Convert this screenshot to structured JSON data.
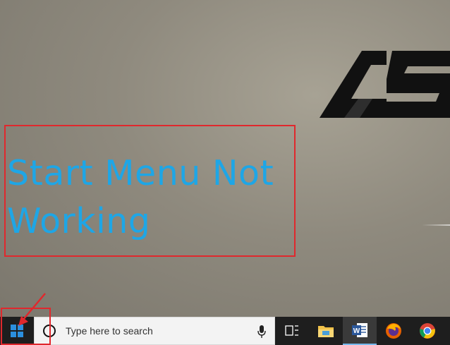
{
  "desktop": {
    "wallpaper_logo": "ASUS",
    "callout_text": "Start Menu Not Working",
    "callout_color": "#1ea6e6",
    "annotation_color": "#e0282d"
  },
  "taskbar": {
    "start_icon": "windows-logo-icon",
    "search_placeholder": "Type here to search",
    "apps": [
      {
        "name": "task-view",
        "icon": "task-view-icon"
      },
      {
        "name": "file-explorer",
        "icon": "folder-icon"
      },
      {
        "name": "word",
        "icon": "word-icon",
        "active": true
      },
      {
        "name": "firefox",
        "icon": "firefox-icon"
      },
      {
        "name": "chrome",
        "icon": "chrome-icon"
      }
    ],
    "background": "#1e1e1e",
    "accent": "#76b9ed"
  }
}
